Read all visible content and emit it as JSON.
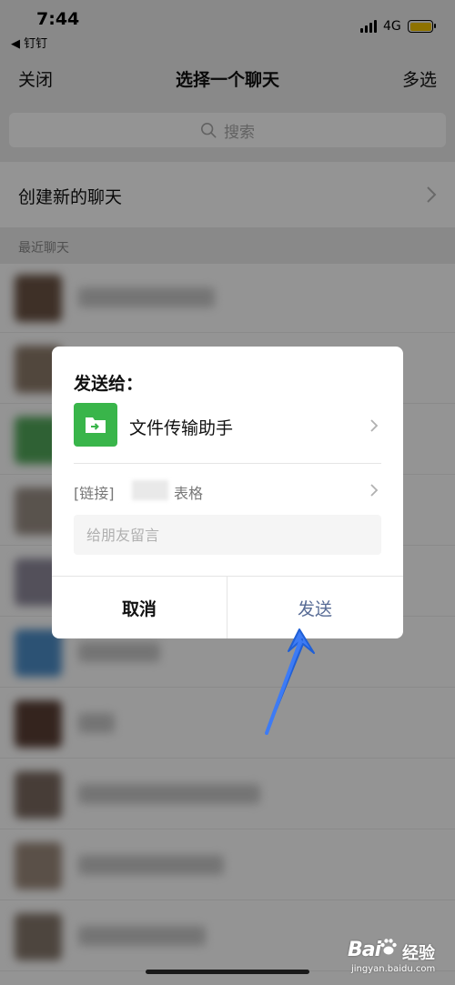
{
  "status_bar": {
    "time": "7:44",
    "back_app": "◀ 钉钉",
    "network": "4G",
    "battery_color": "#f5c400"
  },
  "nav": {
    "close": "关闭",
    "title": "选择一个聊天",
    "multi_select": "多选"
  },
  "search": {
    "placeholder": "搜索",
    "icon": "search-icon"
  },
  "new_chat": {
    "label": "创建新的聊天",
    "icon": "chevron-right-icon"
  },
  "recent_section": {
    "label": "最近聊天"
  },
  "chat_list": {
    "note": "blurred rows"
  },
  "dialog": {
    "title": "发送给：",
    "recipient": {
      "name": "文件传输助手",
      "icon": "file-transfer-folder-icon",
      "icon_color": "#39b54a"
    },
    "link": {
      "prefix": "[链接]",
      "suffix": "表格"
    },
    "message_placeholder": "给朋友留言",
    "cancel": "取消",
    "send": "发送",
    "send_color": "#576b95"
  },
  "annotation": {
    "arrow_color": "#3d7bf5"
  },
  "watermark": {
    "brand": "Bai",
    "sub": "经验",
    "url": "jingyan.baidu.com"
  }
}
